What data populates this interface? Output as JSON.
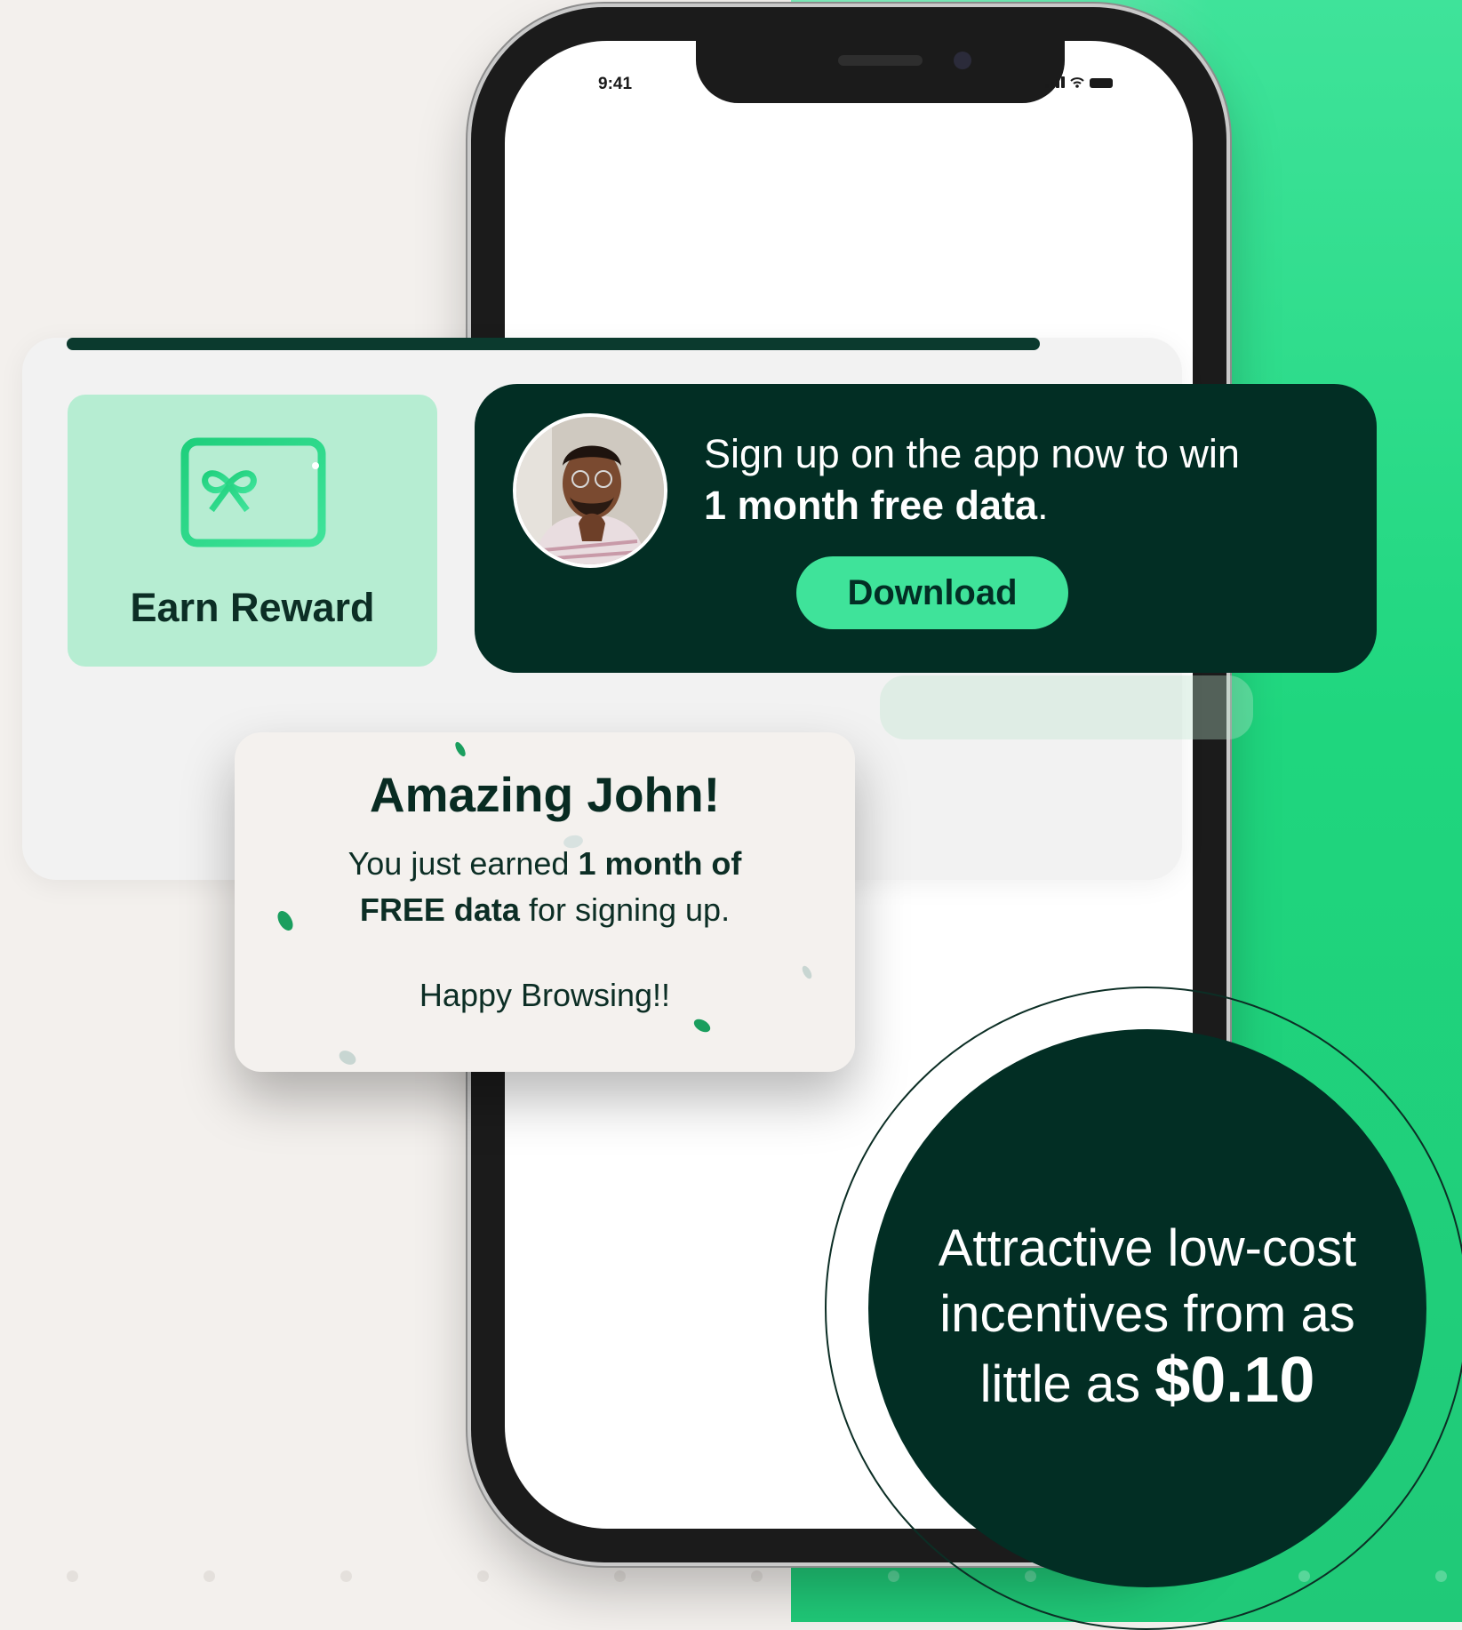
{
  "phone": {
    "status_time": "9:41"
  },
  "reward_tile": {
    "label": "Earn Reward",
    "icon": "gift-card-icon"
  },
  "promo": {
    "line1": "Sign up on the app now to win",
    "line2_bold": "1 month free data",
    "line2_end": ".",
    "button_label": "Download"
  },
  "popup": {
    "title": "Amazing John!",
    "body_start": "You just earned ",
    "body_bold_1": "1 month of",
    "body_bold_2": "FREE data",
    "body_end": " for signing up.",
    "footer": "Happy Browsing!!"
  },
  "badge": {
    "line1": "Attractive low-cost",
    "line2": "incentives from as",
    "line3_start": "little as ",
    "price": "$0.10"
  },
  "colors": {
    "brand_dark": "#022e24",
    "brand_green": "#3fe39a",
    "tile_green": "#b6edd2",
    "background": "#f3f0ed"
  }
}
